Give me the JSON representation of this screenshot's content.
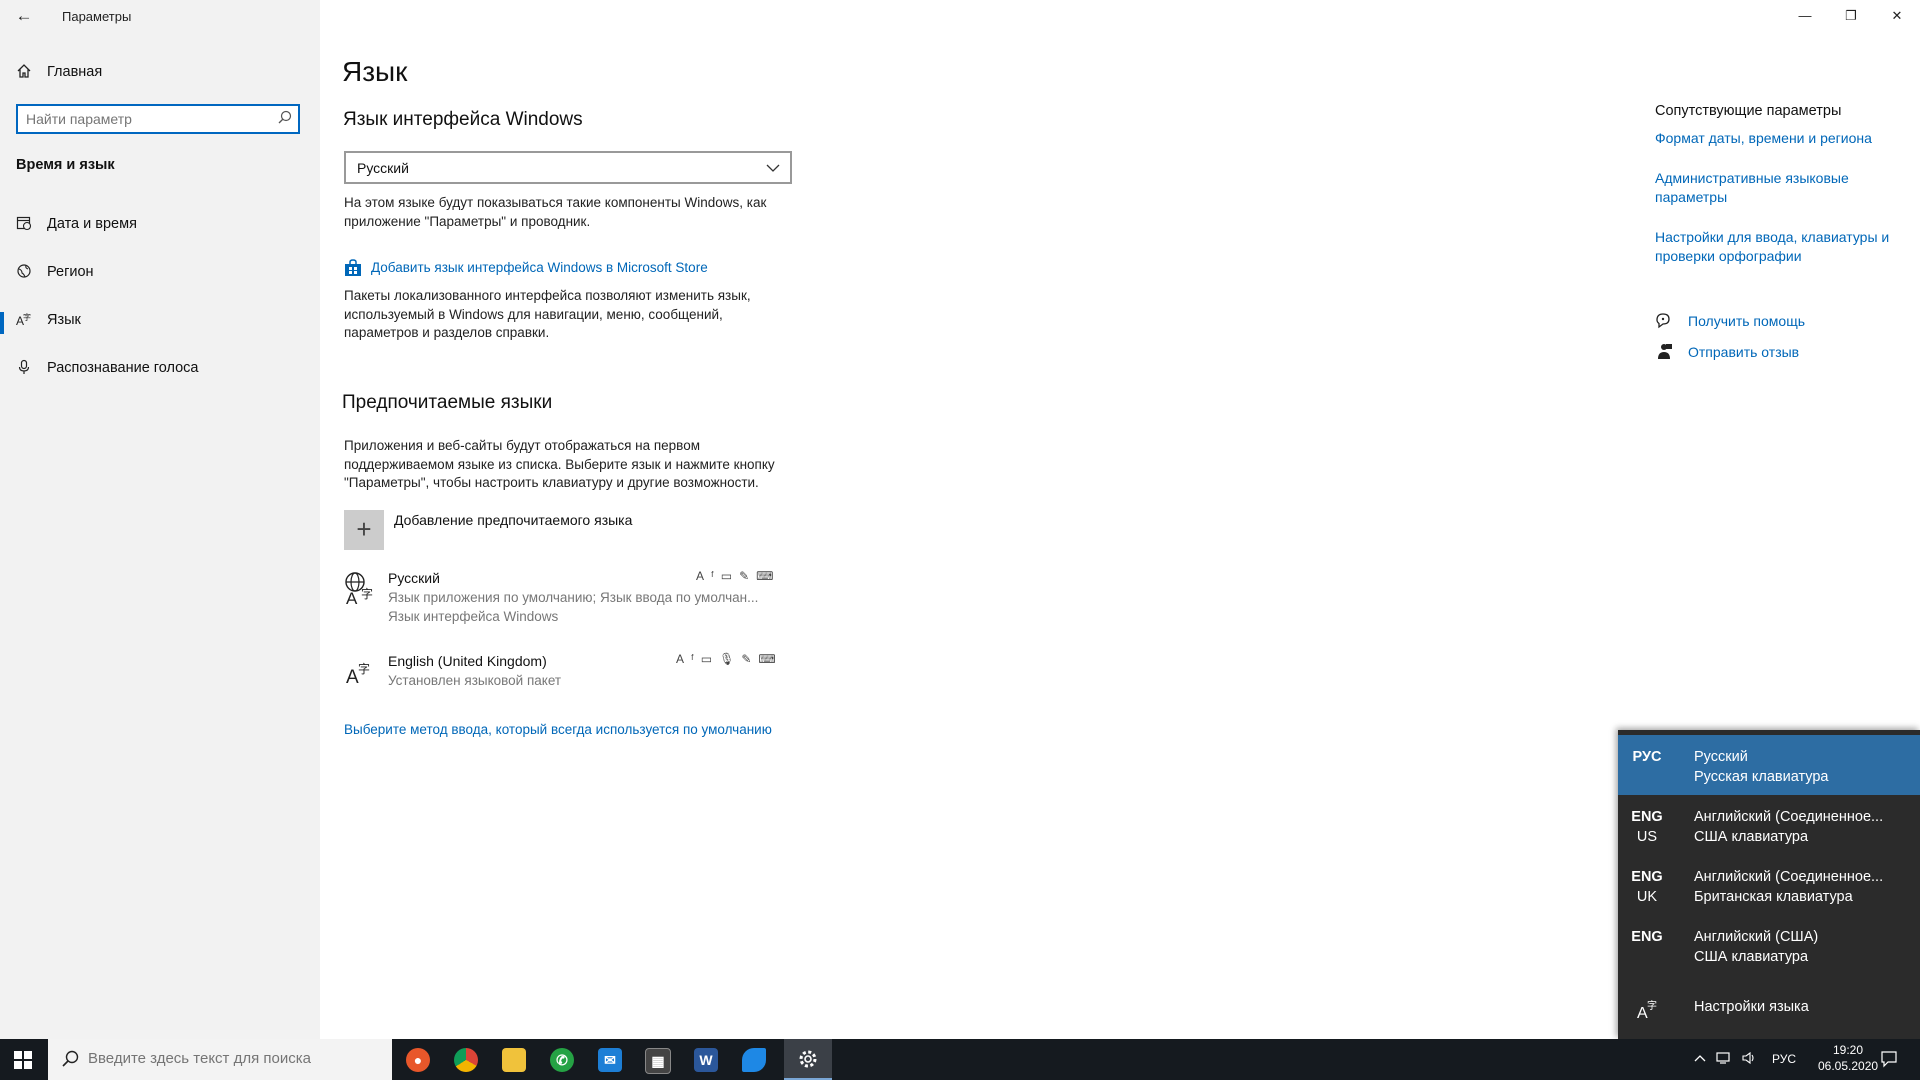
{
  "window": {
    "title": "Параметры",
    "minimize": "—",
    "maximize": "❐",
    "close": "✕",
    "back": "←"
  },
  "sidebar": {
    "home": "Главная",
    "search_placeholder": "Найти параметр",
    "section": "Время и язык",
    "items": [
      {
        "label": "Дата и время",
        "icon": "clock-calendar-icon"
      },
      {
        "label": "Регион",
        "icon": "globe-region-icon"
      },
      {
        "label": "Язык",
        "icon": "language-icon"
      },
      {
        "label": "Распознавание голоса",
        "icon": "microphone-icon"
      }
    ]
  },
  "main": {
    "title": "Язык",
    "display_lang": {
      "heading": "Язык интерфейса Windows",
      "selected": "Русский",
      "desc": "На этом языке будут показываться такие компоненты Windows, как приложение \"Параметры\" и проводник.",
      "store_link": "Добавить язык интерфейса Windows в Microsoft Store",
      "store_desc": "Пакеты локализованного интерфейса позволяют изменить язык, используемый в Windows для навигации, меню, сообщений, параметров и разделов справки."
    },
    "preferred": {
      "heading": "Предпочитаемые языки",
      "desc": "Приложения и веб-сайты будут отображаться на первом поддерживаемом языке из списка. Выберите язык и нажмите кнопку \"Параметры\", чтобы настроить клавиатуру и другие возможности.",
      "add_label": "Добавление предпочитаемого языка",
      "languages": [
        {
          "name": "Русский",
          "sub1": "Язык приложения по умолчанию; Язык ввода по умолчан...",
          "sub2": "Язык интерфейса Windows"
        },
        {
          "name": "English (United Kingdom)",
          "sub1": "Установлен языковой пакет",
          "sub2": ""
        }
      ],
      "method_link": "Выберите метод ввода, который всегда используется по умолчанию"
    }
  },
  "related": {
    "title": "Сопутствующие параметры",
    "links": [
      "Формат даты, времени и региона",
      "Административные языковые параметры",
      "Настройки для ввода, клавиатуры и проверки орфографии"
    ],
    "help": "Получить помощь",
    "feedback": "Отправить отзыв"
  },
  "flyout": {
    "items": [
      {
        "code": "РУС",
        "code2": "",
        "name": "Русский",
        "kb": "Русская клавиатура",
        "selected": true
      },
      {
        "code": "ENG",
        "code2": "US",
        "name": "Английский (Соединенное...",
        "kb": "США клавиатура",
        "selected": false
      },
      {
        "code": "ENG",
        "code2": "UK",
        "name": "Английский (Соединенное...",
        "kb": "Британская клавиатура",
        "selected": false
      },
      {
        "code": "ENG",
        "code2": "",
        "name": "Английский (США)",
        "kb": "США клавиатура",
        "selected": false
      }
    ],
    "settings": "Настройки языка"
  },
  "taskbar": {
    "search_placeholder": "Введите здесь текст для поиска",
    "lang": "РУС",
    "time": "19:20",
    "date": "06.05.2020",
    "apps": [
      "firefox-icon",
      "chrome-icon",
      "file-explorer-icon",
      "whatsapp-icon",
      "mail-icon",
      "calculator-icon",
      "word-icon",
      "cloud-app-icon",
      "settings-gear-icon"
    ]
  },
  "colors": {
    "accent": "#0067b8",
    "flyout_bg": "#2b2b2b",
    "flyout_selected": "#2d6da3",
    "taskbar": "#151a1f"
  }
}
